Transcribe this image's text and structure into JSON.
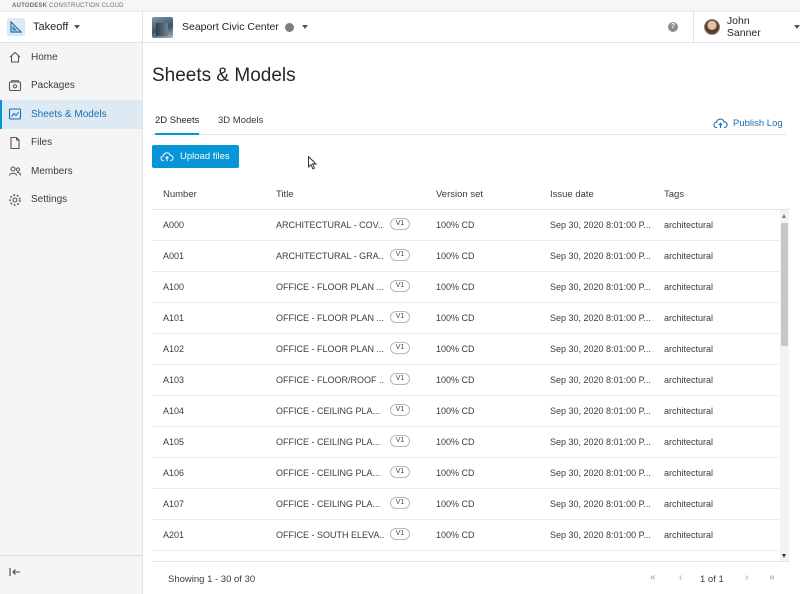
{
  "brand": {
    "top_strip": "AUTODESK CONSTRUCTION CLOUD",
    "top_strip_bold": "AUTODESK",
    "top_strip_rest": " CONSTRUCTION CLOUD"
  },
  "header": {
    "app_name": "Takeoff",
    "project_name": "Seaport Civic Center",
    "help_label": "?",
    "user_name": "John Sanner"
  },
  "sidebar": {
    "items": [
      {
        "label": "Home",
        "icon": "home-icon"
      },
      {
        "label": "Packages",
        "icon": "packages-icon"
      },
      {
        "label": "Sheets & Models",
        "icon": "sheets-icon",
        "active": true
      },
      {
        "label": "Files",
        "icon": "files-icon"
      },
      {
        "label": "Members",
        "icon": "members-icon"
      },
      {
        "label": "Settings",
        "icon": "gear-icon"
      }
    ],
    "collapse_icon": "collapse-sidebar-icon"
  },
  "main": {
    "title": "Sheets & Models",
    "tabs": [
      {
        "label": "2D Sheets",
        "active": true
      },
      {
        "label": "3D Models"
      }
    ],
    "publish_log": "Publish Log",
    "upload_button": "Upload files"
  },
  "table": {
    "columns": [
      "Number",
      "Title",
      "Version set",
      "Issue date",
      "Tags"
    ],
    "rows": [
      {
        "number": "A000",
        "title": "ARCHITECTURAL - COV...",
        "version": "V1",
        "version_set": "100% CD",
        "issue_date": "Sep 30, 2020 8:01:00 P...",
        "tags": "architectural"
      },
      {
        "number": "A001",
        "title": "ARCHITECTURAL - GRA...",
        "version": "V1",
        "version_set": "100% CD",
        "issue_date": "Sep 30, 2020 8:01:00 P...",
        "tags": "architectural"
      },
      {
        "number": "A100",
        "title": "OFFICE - FLOOR PLAN ...",
        "version": "V1",
        "version_set": "100% CD",
        "issue_date": "Sep 30, 2020 8:01:00 P...",
        "tags": "architectural"
      },
      {
        "number": "A101",
        "title": "OFFICE - FLOOR PLAN ...",
        "version": "V1",
        "version_set": "100% CD",
        "issue_date": "Sep 30, 2020 8:01:00 P...",
        "tags": "architectural"
      },
      {
        "number": "A102",
        "title": "OFFICE - FLOOR PLAN ...",
        "version": "V1",
        "version_set": "100% CD",
        "issue_date": "Sep 30, 2020 8:01:00 P...",
        "tags": "architectural"
      },
      {
        "number": "A103",
        "title": "OFFICE - FLOOR/ROOF ...",
        "version": "V1",
        "version_set": "100% CD",
        "issue_date": "Sep 30, 2020 8:01:00 P...",
        "tags": "architectural"
      },
      {
        "number": "A104",
        "title": "OFFICE - CEILING PLA...",
        "version": "V1",
        "version_set": "100% CD",
        "issue_date": "Sep 30, 2020 8:01:00 P...",
        "tags": "architectural"
      },
      {
        "number": "A105",
        "title": "OFFICE - CEILING PLA...",
        "version": "V1",
        "version_set": "100% CD",
        "issue_date": "Sep 30, 2020 8:01:00 P...",
        "tags": "architectural"
      },
      {
        "number": "A106",
        "title": "OFFICE - CEILING PLA...",
        "version": "V1",
        "version_set": "100% CD",
        "issue_date": "Sep 30, 2020 8:01:00 P...",
        "tags": "architectural"
      },
      {
        "number": "A107",
        "title": "OFFICE - CEILING PLA...",
        "version": "V1",
        "version_set": "100% CD",
        "issue_date": "Sep 30, 2020 8:01:00 P...",
        "tags": "architectural"
      },
      {
        "number": "A201",
        "title": "OFFICE - SOUTH ELEVA...",
        "version": "V1",
        "version_set": "100% CD",
        "issue_date": "Sep 30, 2020 8:01:00 P...",
        "tags": "architectural"
      }
    ]
  },
  "footer": {
    "showing": "Showing 1 - 30 of 30",
    "first_icon": "«",
    "prev_icon": "‹",
    "page_info": "1 of 1",
    "next_icon": "›",
    "last_icon": "»"
  },
  "colors": {
    "accent": "#0696d7",
    "link": "#1b6fab",
    "active_bg": "#dde9f3"
  }
}
